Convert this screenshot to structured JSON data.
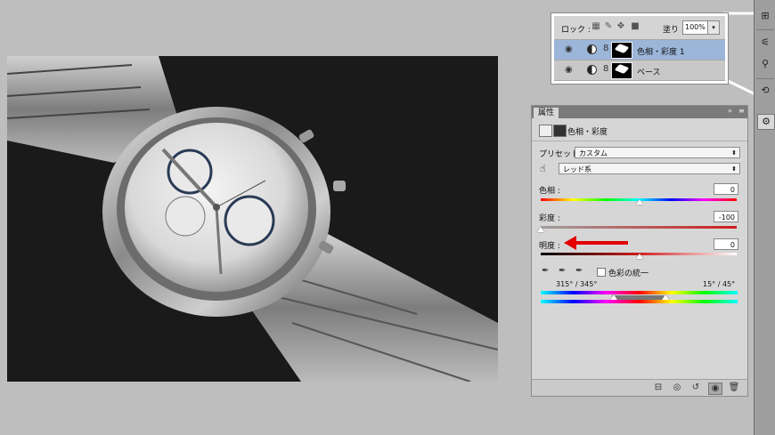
{
  "layers": {
    "lock_label": "ロック :",
    "fill_label": "塗り :",
    "fill_value": "100%",
    "rows": [
      {
        "name": "色相・彩度 1",
        "selected": true
      },
      {
        "name": "ベース",
        "selected": false
      }
    ]
  },
  "properties": {
    "tab_label": "属性",
    "title": "色相・彩度",
    "preset_label": "プリセット :",
    "preset_value": "カスタム",
    "channel_value": "レッド系",
    "hue_label": "色相 :",
    "hue_value": "0",
    "saturation_label": "彩度 :",
    "saturation_value": "-100",
    "lightness_label": "明度 :",
    "lightness_value": "0",
    "colorize_label": "色彩の統一",
    "range_left": "315° / 345°",
    "range_right": "15° / 45°"
  },
  "colors": {
    "arrow": "#e30000",
    "selected_layer": "#9cb6d9"
  },
  "icons": {
    "strip": [
      "levels-icon",
      "adjust-sliders-icon",
      "brush-settings-icon",
      "history-icon",
      "properties-icon"
    ],
    "bottom": [
      "clip-icon",
      "view-previous-icon",
      "reset-icon",
      "visibility-icon",
      "trash-icon"
    ]
  }
}
